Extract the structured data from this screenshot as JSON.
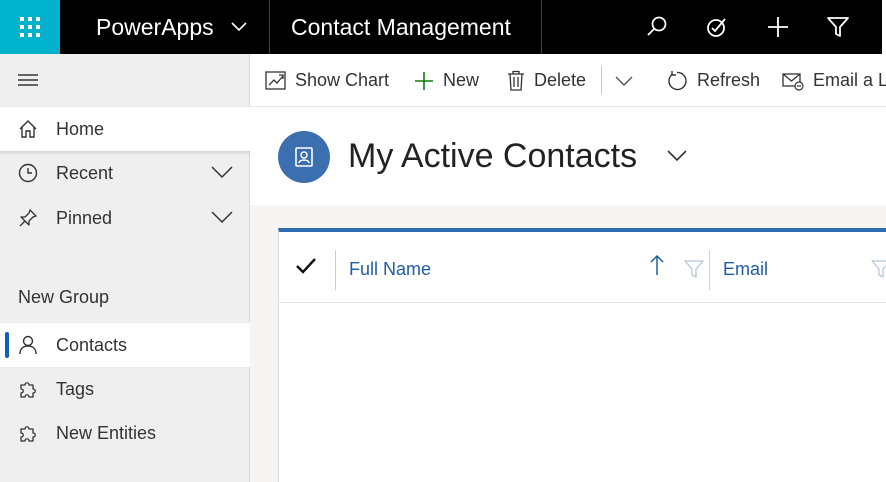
{
  "topbar": {
    "brand": "PowerApps",
    "app_title": "Contact Management",
    "icons": [
      "search-icon",
      "assistant-icon",
      "new-icon",
      "filter-icon"
    ],
    "waffle_color": "#00b2cc"
  },
  "sidebar": {
    "items": [
      {
        "label": "Home",
        "icon": "home-icon"
      },
      {
        "label": "Recent",
        "icon": "clock-icon"
      },
      {
        "label": "Pinned",
        "icon": "pin-icon"
      }
    ],
    "group": {
      "title": "New Group",
      "items": [
        {
          "label": "Contacts",
          "icon": "person-icon",
          "selected": true
        },
        {
          "label": "Tags",
          "icon": "puzzle-icon"
        },
        {
          "label": "New Entities",
          "icon": "puzzle-icon"
        }
      ]
    }
  },
  "commandbar": {
    "show_chart": "Show Chart",
    "new": "New",
    "delete": "Delete",
    "refresh": "Refresh",
    "email_link": "Email a Link"
  },
  "view": {
    "title": "My Active Contacts",
    "accent": "#2f6bb3"
  },
  "grid": {
    "columns": [
      {
        "label": "Full Name",
        "sorted": "ascending"
      },
      {
        "label": "Email"
      }
    ],
    "rows": []
  }
}
